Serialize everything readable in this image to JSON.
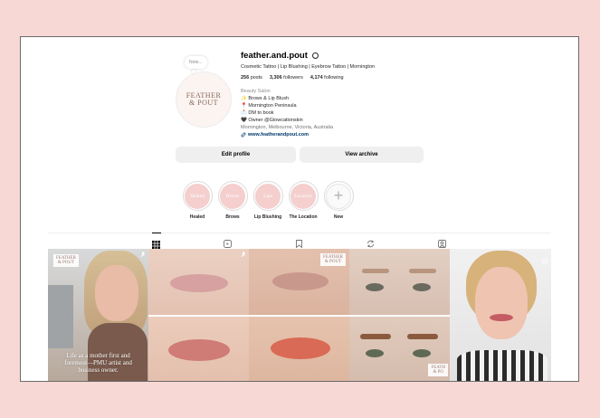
{
  "profile": {
    "note": "Note...",
    "avatar_logo": [
      "FEATHER",
      "& POUT"
    ],
    "username": "feather.and.pout",
    "bio_headline": "Cosmetic Tattoo | Lip Blushing | Eyebrow Tattoo | Mornington",
    "stats": {
      "posts": "256",
      "posts_label": "posts",
      "followers": "3,306",
      "followers_label": "followers",
      "following": "4,174",
      "following_label": "following"
    },
    "category": "Beauty Salon",
    "bio_lines": [
      "✨ Brows & Lip Blush",
      "📍 Mornington Peninsula",
      "📩 DM to book",
      "🖤 Owner @Glowcationskin"
    ],
    "address": "Mornington, Melbourne, Victoria, Australia",
    "link": "www.featherandpout.com"
  },
  "buttons": {
    "edit_profile": "Edit profile",
    "view_archive": "View archive"
  },
  "highlights": [
    {
      "inner": "Healed",
      "caption": "Healed"
    },
    {
      "inner": "Brows",
      "caption": "Brows"
    },
    {
      "inner": "Lips",
      "caption": "Lip Blushing"
    },
    {
      "inner": "Location",
      "caption": "The Location"
    },
    {
      "inner": "+",
      "caption": "New"
    }
  ],
  "tabs": [
    "grid-icon",
    "reels-icon",
    "saved-icon",
    "repost-icon",
    "tagged-icon"
  ],
  "posts": {
    "p1_logo": [
      "FEATHER",
      "& POUT"
    ],
    "p1_caption": "Life as a mother first and foremost—PMU artist and business owner.",
    "p3_logo": [
      "FEATHER",
      "& POUT"
    ],
    "p4_logo": [
      "FEATH",
      "& PO"
    ]
  },
  "colors": {
    "background": "#f7d8d4",
    "highlight_fill": "#f4cfcd",
    "link": "#00376b"
  }
}
